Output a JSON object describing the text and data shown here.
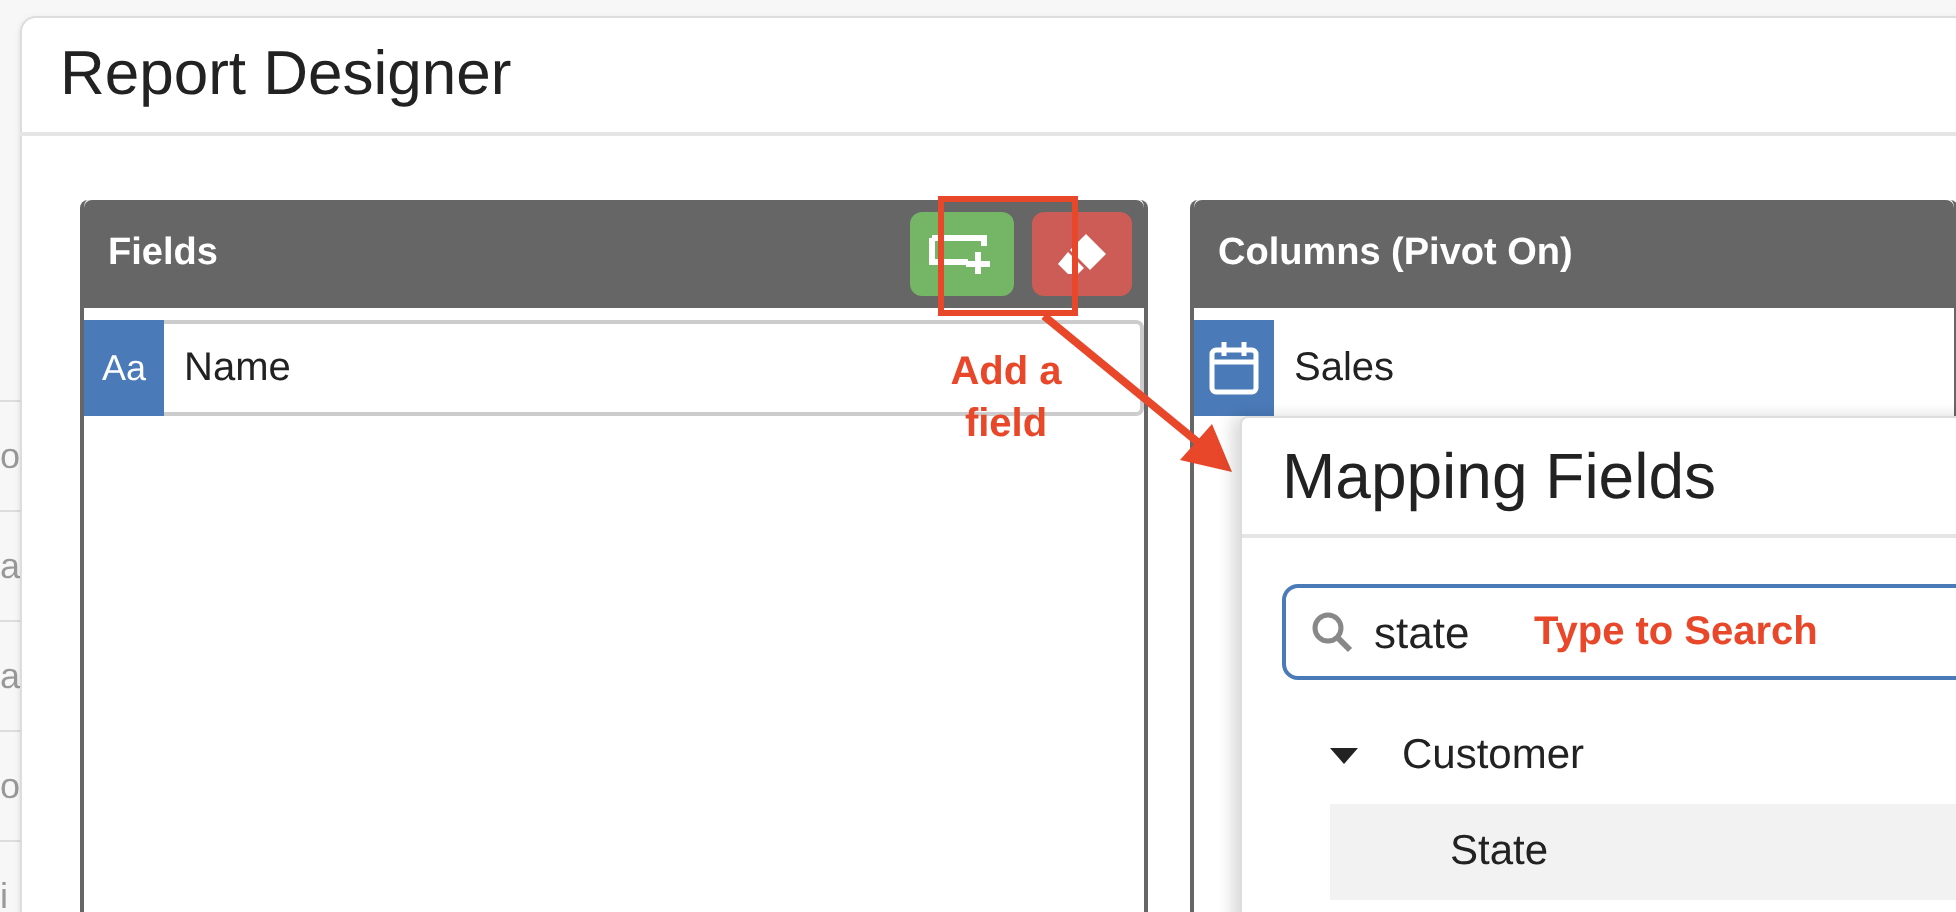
{
  "background_list": [
    "o",
    "a",
    "a",
    "o",
    "i"
  ],
  "dialog": {
    "title": "Report Designer"
  },
  "fields_panel": {
    "title": "Fields",
    "items": [
      {
        "kind": "text",
        "badge": "Aa",
        "label": "Name"
      }
    ]
  },
  "columns_panel": {
    "title": "Columns (Pivot On)",
    "items": [
      {
        "kind": "date",
        "label": "Sales"
      }
    ]
  },
  "annotations": [
    {
      "text": "Add a field"
    },
    {
      "text": "Type to Search"
    }
  ],
  "mapping_popup": {
    "title": "Mapping Fields",
    "search": {
      "value": "state"
    },
    "tree": [
      {
        "label": "Customer",
        "expanded": true,
        "selected": false,
        "children": [
          {
            "label": "State",
            "selected": true
          }
        ]
      }
    ]
  }
}
